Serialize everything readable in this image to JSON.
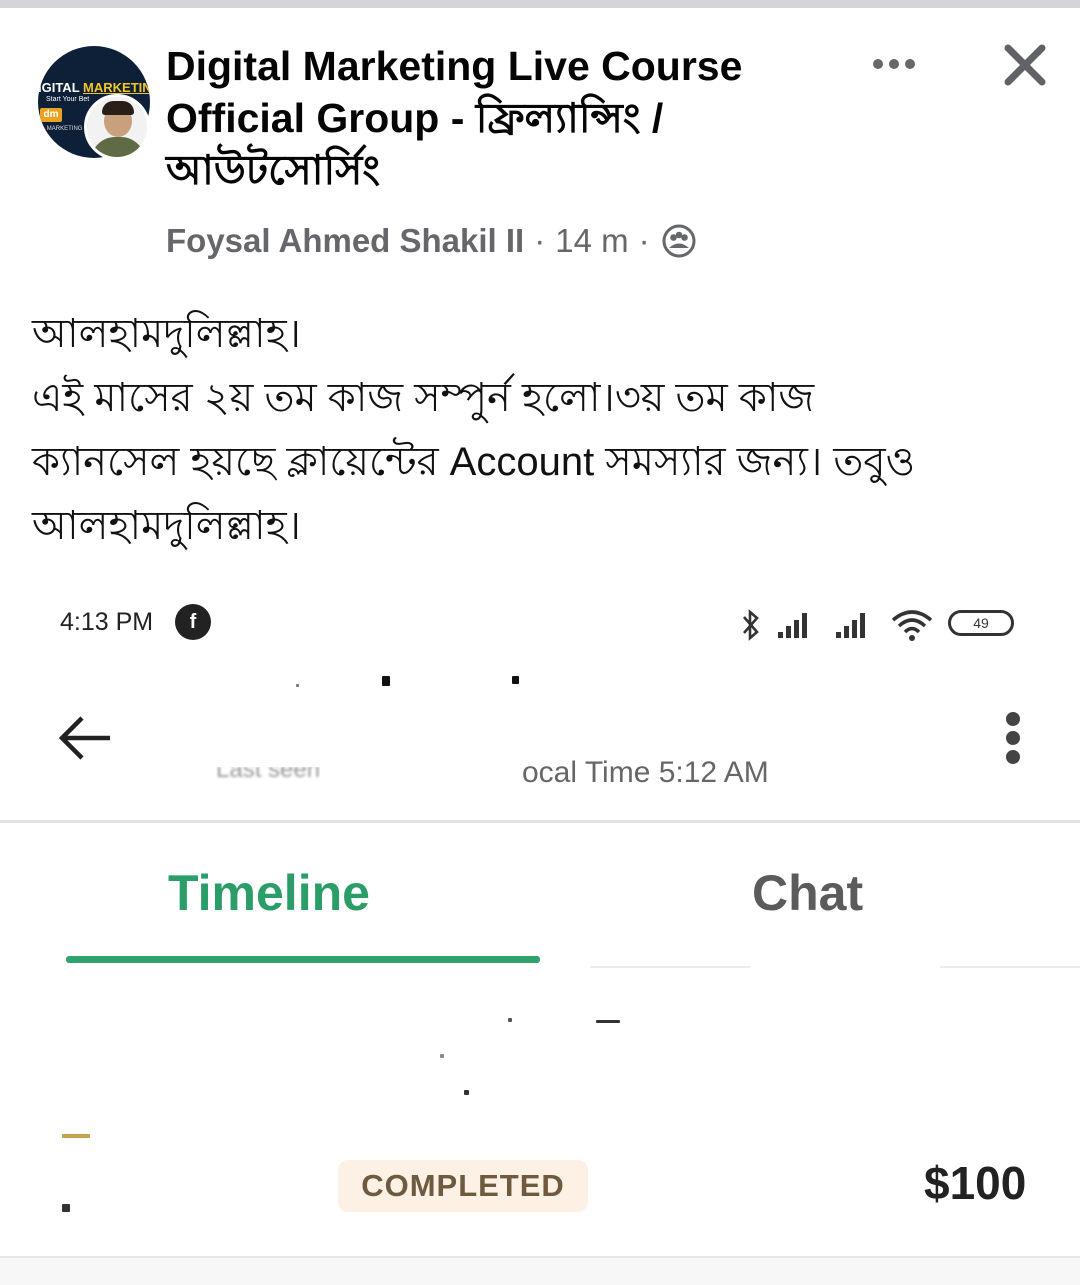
{
  "post": {
    "group_name": "Digital Marketing Live Course Official Group - ফ্রিল্যান্সিং / আউটসোর্সিং",
    "author": "Foysal Ahmed Shakil II",
    "time": "14 m",
    "group_avatar": {
      "title_a": "IGITAL ",
      "title_b": "MARKETING",
      "subtitle": "Start Your Bet",
      "logo": "dm",
      "logo_sub": "AL MARKETING"
    },
    "body_lines": [
      "আলহামদুলিল্লাহ।",
      "এই মাসের ২য় তম কাজ সম্পুর্ন হলো।৩য় তম কাজ",
      "ক্যানসেল হয়ছে ক্লায়েন্টের Account সমস্যার জন্য।  তবুও",
      "আলহামদুলিল্লাহ।"
    ]
  },
  "screenshot": {
    "status_time": "4:13 PM",
    "fb_badge": "f",
    "battery": "49",
    "last_seen": "Last seen",
    "local_time": "ocal Time 5:12 AM",
    "tabs": [
      "Timeline",
      "Chat"
    ],
    "badge": "COMPLETED",
    "amount": "$100"
  },
  "colors": {
    "accent_green": "#2ea36c",
    "meta_gray": "#65676b",
    "badge_bg": "#fdf0e4"
  },
  "icons": [
    "more-icon",
    "close-icon",
    "privacy-group-icon",
    "back-arrow-icon",
    "kebab-menu-icon",
    "bluetooth-icon",
    "signal-icon",
    "wifi-icon",
    "battery-icon"
  ]
}
